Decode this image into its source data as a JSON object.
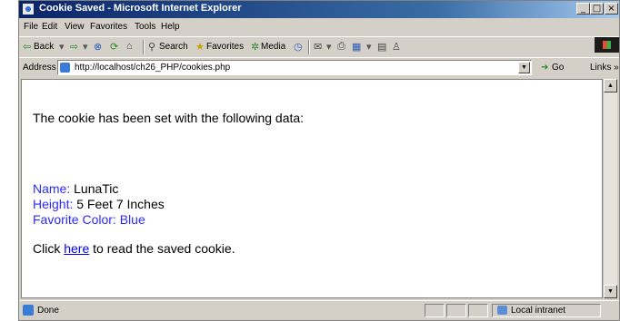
{
  "window": {
    "title": "Cookie Saved - Microsoft Internet Explorer",
    "min_glyph": "_",
    "max_glyph": "□",
    "close_glyph": "×"
  },
  "menu": [
    "File",
    "Edit",
    "View",
    "Favorites",
    "Tools",
    "Help"
  ],
  "toolbar": {
    "back": "Back",
    "search": "Search",
    "favorites": "Favorites",
    "media": "Media"
  },
  "address": {
    "label": "Address",
    "value": "http://localhost/ch26_PHP/cookies.php",
    "go_label": "Go",
    "links_label": "Links »"
  },
  "page": {
    "intro": "The cookie has been set with the following data:",
    "fields": [
      {
        "label": "Name:",
        "value": "LunaTic"
      },
      {
        "label": "Height:",
        "value": "5 Feet 7 Inches"
      },
      {
        "label": "Favorite Color:",
        "value": "Blue"
      }
    ],
    "click_prefix": "Click",
    "link_text": "here",
    "click_suffix": "to read the saved cookie."
  },
  "status": {
    "text": "Done",
    "zone": "Local intranet"
  },
  "colors": {
    "field_label": "#2a2aff",
    "link": "#0000ee",
    "title_bar": "#0a246a"
  }
}
